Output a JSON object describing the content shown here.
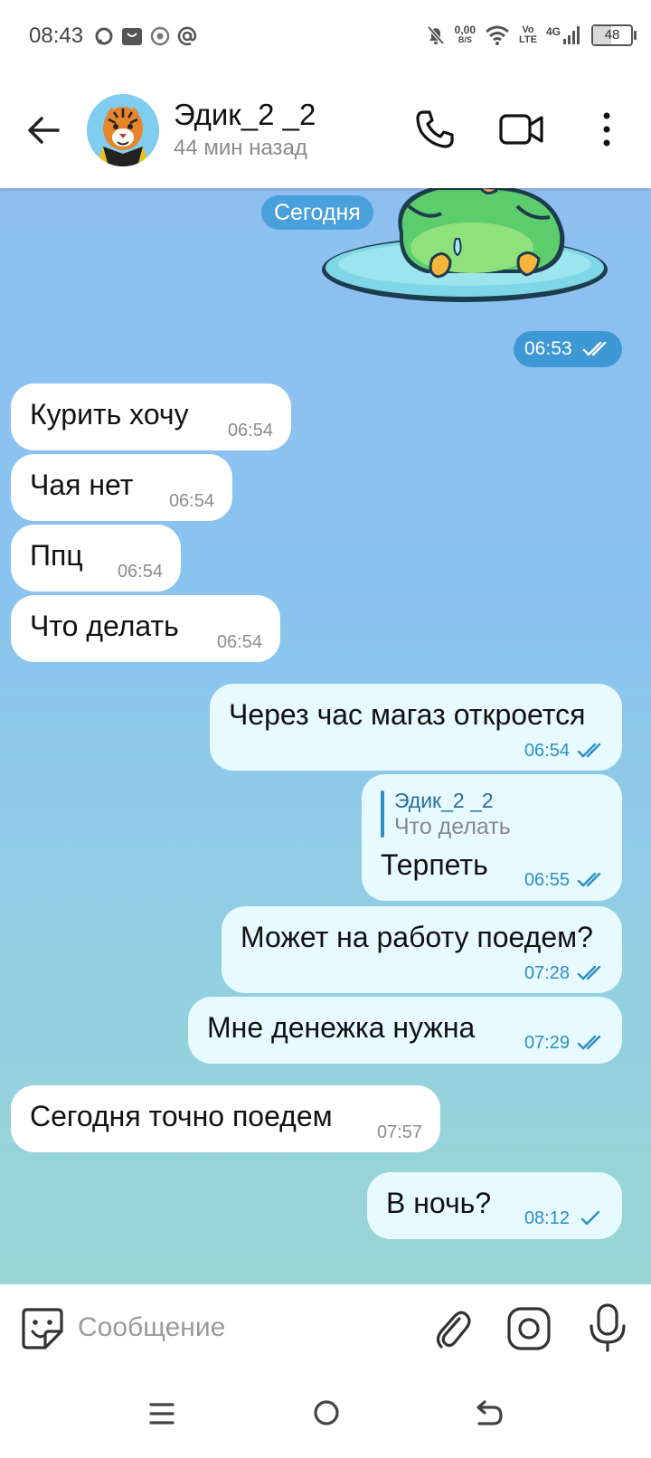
{
  "status_bar": {
    "time": "08:43",
    "net_speed_value": "0,00",
    "net_speed_unit": "B/S",
    "volte_top": "Vo",
    "volte_bottom": "LTE",
    "network": "4G",
    "battery": "48",
    "battery_level": 0.48
  },
  "header": {
    "contact_name": "Эдик_2 _2",
    "last_seen": "44 мин назад"
  },
  "chat": {
    "date_separator": "Сегодня",
    "sticker_time": "06:53",
    "messages": [
      {
        "dir": "in",
        "text": "Курить хочу",
        "time": "06:54"
      },
      {
        "dir": "in",
        "text": "Чая нет",
        "time": "06:54"
      },
      {
        "dir": "in",
        "text": "Ппц",
        "time": "06:54"
      },
      {
        "dir": "in",
        "text": "Что делать",
        "time": "06:54"
      },
      {
        "dir": "out",
        "text": "Через час магаз откроется",
        "time": "06:54",
        "status": "read"
      },
      {
        "dir": "out",
        "text": "Терпеть",
        "time": "06:55",
        "status": "read",
        "reply_name": "Эдик_2 _2",
        "reply_text": "Что делать"
      },
      {
        "dir": "out",
        "text": "Может на работу поедем?",
        "time": "07:28",
        "status": "read"
      },
      {
        "dir": "out",
        "text": "Мне денежка нужна",
        "time": "07:29",
        "status": "read"
      },
      {
        "dir": "in",
        "text": "Сегодня точно поедем",
        "time": "07:57"
      },
      {
        "dir": "out",
        "text": "В ночь?",
        "time": "08:12",
        "status": "sent"
      }
    ]
  },
  "composer": {
    "placeholder": "Сообщение"
  },
  "icons": {
    "back": "arrow-left-icon",
    "call": "phone-icon",
    "video": "video-camera-icon",
    "menu": "kebab-menu-icon",
    "emoji": "sticker-smile-icon",
    "attach": "paperclip-icon",
    "camera": "instagram-camera-icon",
    "mic": "microphone-icon"
  },
  "colors": {
    "accent": "#2d8fc2",
    "date_pill": "#4aa0dc",
    "incoming_bubble": "#ffffff",
    "outgoing_bubble": "#e6faff"
  }
}
